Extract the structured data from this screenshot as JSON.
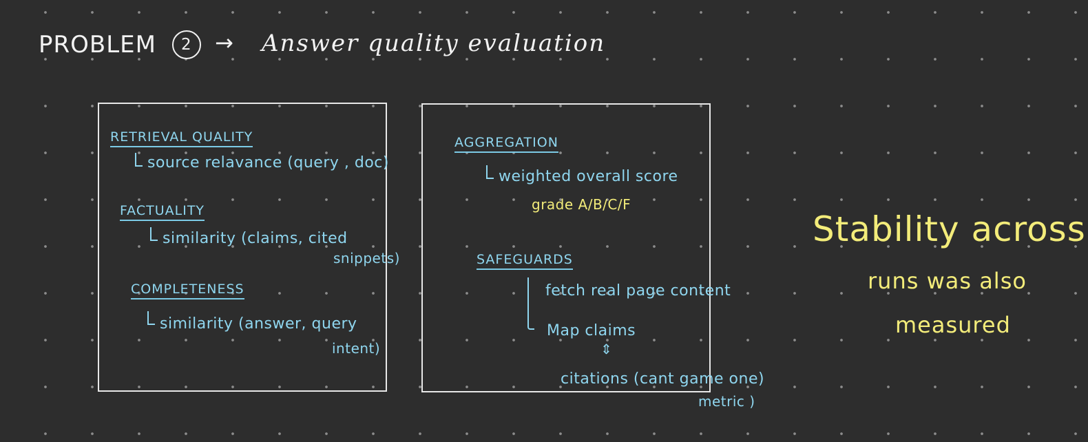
{
  "title": {
    "problem": "PROBLEM",
    "number": "2",
    "arrow": "→",
    "subject": "Answer quality evaluation"
  },
  "left_box": {
    "retrieval": {
      "heading": "RETRIEVAL QUALITY",
      "detail": "source relavance (query , doc)"
    },
    "factuality": {
      "heading": "FACTUALITY",
      "detail_line1": "similarity (claims, cited",
      "detail_line2": "snippets)"
    },
    "completeness": {
      "heading": "COMPLETENESS",
      "detail_line1": "similarity (answer, query",
      "detail_line2": "intent)"
    }
  },
  "right_box": {
    "aggregation": {
      "heading": "AGGREGATION",
      "detail": "weighted overall score",
      "grade": "grade A/B/C/F"
    },
    "safeguards": {
      "heading": "SAFEGUARDS",
      "item1": "fetch real page content",
      "item2": "Map claims",
      "double_arrow": "⇕",
      "item3_line1": "citations (cant game one)",
      "item3_line2": "metric )"
    }
  },
  "side_note": {
    "line1": "Stability across",
    "line2": "runs was also",
    "line3": "measured"
  },
  "colors": {
    "background": "#2d2d2d",
    "dots": "#8c8c8c",
    "title": "#f2f2f2",
    "text_blue": "#8fd6ef",
    "text_yellow": "#f3ec7a",
    "box_border": "#e8e8e8"
  }
}
